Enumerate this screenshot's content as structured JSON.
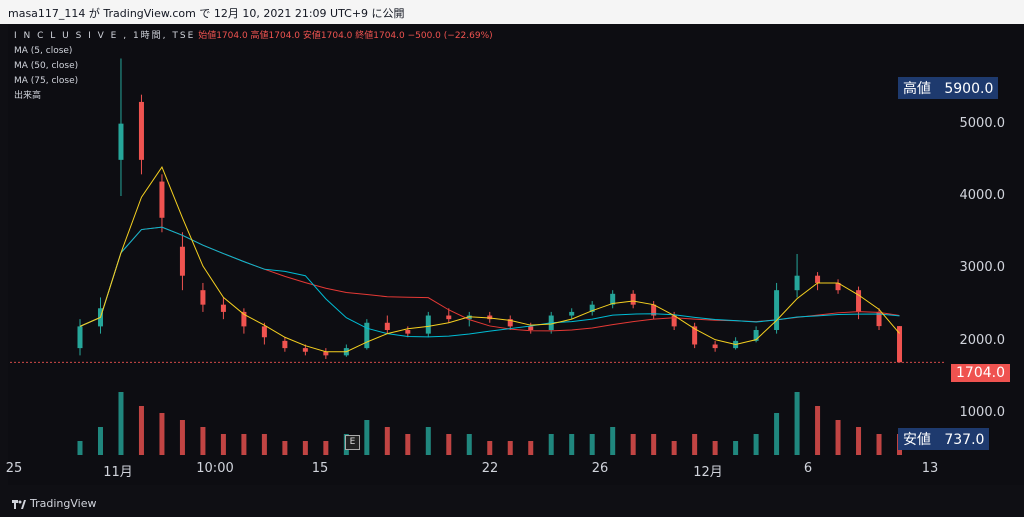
{
  "header": {
    "text": "masa117_114 が TradingView.com で 12月 10, 2021 21:09 UTC+9 に公開"
  },
  "legend": {
    "symbol": "I N C L U S I V E , 1時間, TSE",
    "ohlc": "始値1704.0 高値1704.0 安値1704.0 終値1704.0 −500.0 (−22.69%)",
    "ma5": "MA (5, close)",
    "ma50": "MA (50, close)",
    "ma75": "MA (75, close)",
    "volume": "出来高"
  },
  "price_axis": {
    "ticks": [
      "5000.0",
      "4000.0",
      "3000.0",
      "2000.0",
      "1000.0"
    ],
    "high_label": "高値",
    "high_value": "5900.0",
    "low_label": "安値",
    "low_value": "737.0",
    "last_value": "1704.0"
  },
  "time_axis": {
    "labels": [
      "25",
      "11月",
      "10:00",
      "15",
      "22",
      "26",
      "12月",
      "6",
      "13"
    ]
  },
  "event_marker": "E",
  "footer": {
    "logo_text": "TradingView"
  },
  "colors": {
    "up": "#26a69a",
    "down": "#ef5350",
    "ma5": "#f5d020",
    "ma50": "#00bcd4",
    "ma75": "#e53935"
  },
  "chart_data": {
    "type": "candlestick",
    "symbol": "INCLUSIVE",
    "interval": "1時間",
    "ylim": [
      700,
      6100
    ],
    "high": 5900,
    "low": 737,
    "last": 1704,
    "candles": [
      [
        1900,
        2300,
        1800,
        2200
      ],
      [
        2200,
        2600,
        2100,
        2450
      ],
      [
        4500,
        5900,
        4000,
        5000
      ],
      [
        5300,
        5400,
        4300,
        4500
      ],
      [
        4200,
        4300,
        3500,
        3700
      ],
      [
        3300,
        3500,
        2700,
        2900
      ],
      [
        2700,
        2800,
        2400,
        2500
      ],
      [
        2500,
        2600,
        2300,
        2400
      ],
      [
        2400,
        2450,
        2100,
        2200
      ],
      [
        2200,
        2250,
        1950,
        2050
      ],
      [
        2000,
        2050,
        1850,
        1900
      ],
      [
        1900,
        1950,
        1800,
        1850
      ],
      [
        1850,
        1900,
        1750,
        1800
      ],
      [
        1800,
        1950,
        1780,
        1900
      ],
      [
        1900,
        2300,
        1880,
        2250
      ],
      [
        2250,
        2350,
        2100,
        2150
      ],
      [
        2150,
        2200,
        2050,
        2100
      ],
      [
        2100,
        2400,
        2050,
        2350
      ],
      [
        2350,
        2450,
        2250,
        2300
      ],
      [
        2300,
        2400,
        2200,
        2350
      ],
      [
        2350,
        2400,
        2250,
        2300
      ],
      [
        2300,
        2350,
        2150,
        2200
      ],
      [
        2200,
        2250,
        2100,
        2150
      ],
      [
        2150,
        2400,
        2100,
        2350
      ],
      [
        2350,
        2450,
        2300,
        2400
      ],
      [
        2400,
        2550,
        2350,
        2500
      ],
      [
        2500,
        2700,
        2450,
        2650
      ],
      [
        2650,
        2700,
        2450,
        2500
      ],
      [
        2500,
        2550,
        2300,
        2350
      ],
      [
        2350,
        2400,
        2150,
        2200
      ],
      [
        2200,
        2250,
        1900,
        1950
      ],
      [
        1950,
        2000,
        1850,
        1900
      ],
      [
        1900,
        2050,
        1880,
        2000
      ],
      [
        2000,
        2200,
        1980,
        2150
      ],
      [
        2150,
        2800,
        2100,
        2700
      ],
      [
        2700,
        3200,
        2600,
        2900
      ],
      [
        2900,
        2950,
        2700,
        2800
      ],
      [
        2800,
        2850,
        2650,
        2700
      ],
      [
        2700,
        2750,
        2300,
        2400
      ],
      [
        2400,
        2450,
        2150,
        2204
      ],
      [
        2204,
        2204,
        1704,
        1704
      ]
    ],
    "volume": [
      2,
      4,
      9,
      7,
      6,
      5,
      4,
      3,
      3,
      3,
      2,
      2,
      2,
      3,
      5,
      4,
      3,
      4,
      3,
      3,
      2,
      2,
      2,
      3,
      3,
      3,
      4,
      3,
      3,
      2,
      3,
      2,
      2,
      3,
      6,
      9,
      7,
      5,
      4,
      3,
      3
    ]
  }
}
